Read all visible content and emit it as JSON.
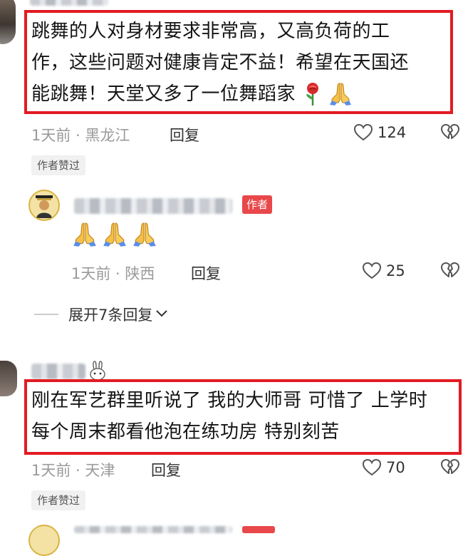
{
  "comments": [
    {
      "text_lines": [
        "跳舞的人对身材要求非常高，又高负荷的工",
        "作，这些问题对健康肯定不益！希望在天国还",
        "能跳舞！天堂又多了一位舞蹈家"
      ],
      "meta": "1天前 · 黑龙江",
      "reply": "回复",
      "likes": "124",
      "author_liked": "作者赞过",
      "emojis": [
        "rose-icon",
        "praying-hands-icon"
      ]
    },
    {
      "text_lines": [
        "刚在军艺群里听说了 我的大师哥 可惜了 上学时",
        "每个周末都看他泡在练功房 特别刻苦"
      ],
      "meta": "1天前 · 天津",
      "reply": "回复",
      "likes": "70",
      "author_liked": "作者赞过"
    }
  ],
  "author_reply": {
    "badge": "作者",
    "emojis": [
      "praying-hands-icon",
      "praying-hands-icon",
      "praying-hands-icon"
    ],
    "meta": "1天前 · 陕西",
    "reply": "回复",
    "likes": "25",
    "expand": "展开7条回复"
  },
  "colors": {
    "highlight_border": "#e21b23",
    "author_badge": "#e8484a"
  }
}
